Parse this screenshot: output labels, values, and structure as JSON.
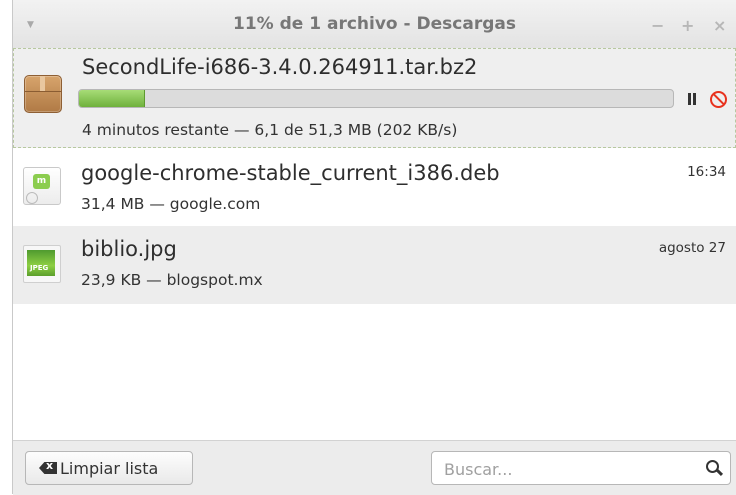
{
  "window": {
    "title": "11% de 1 archivo - Descargas",
    "controls": {
      "minimize": "−",
      "maximize": "+",
      "close": "×"
    }
  },
  "downloads": [
    {
      "filename": "SecondLife-i686-3.4.0.264911.tar.bz2",
      "status": "4 minutos restante — 6,1 de 51,3 MB (202 KB/s)",
      "progress_percent": 11,
      "icon": "package-icon",
      "state": "downloading"
    },
    {
      "filename": "google-chrome-stable_current_i386.deb",
      "status": "31,4 MB — google.com",
      "time": "16:34",
      "icon": "deb-package-icon",
      "state": "completed"
    },
    {
      "filename": "biblio.jpg",
      "status": "23,9 KB — blogspot.mx",
      "time": "agosto 27",
      "icon": "jpeg-image-icon",
      "state": "completed"
    }
  ],
  "footer": {
    "clear_label": "Limpiar lista",
    "search_placeholder": "Buscar..."
  },
  "colors": {
    "progress_fill": "#8cc85a",
    "cancel": "#e8321e"
  }
}
